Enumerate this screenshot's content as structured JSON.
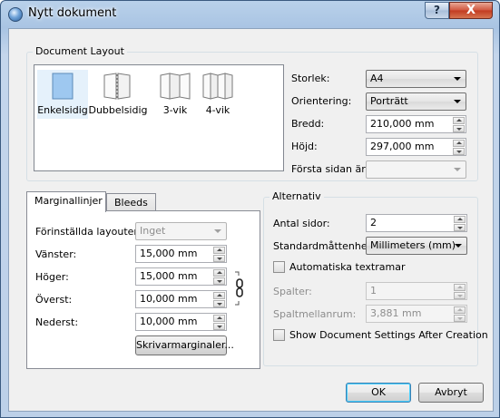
{
  "window": {
    "title": "Nytt dokument"
  },
  "titlebar_buttons": {
    "help": "?",
    "close": "X"
  },
  "document_layout": {
    "title": "Document Layout",
    "options": [
      {
        "label": "Enkelsidig",
        "selected": true
      },
      {
        "label": "Dubbelsidig",
        "selected": false
      },
      {
        "label": "3-vik",
        "selected": false
      },
      {
        "label": "4-vik",
        "selected": false
      }
    ],
    "size_label": "Storlek:",
    "size_value": "A4",
    "orientation_label": "Orientering:",
    "orientation_value": "Porträtt",
    "width_label": "Bredd:",
    "width_value": "210,000 mm",
    "height_label": "Höjd:",
    "height_value": "297,000 mm",
    "first_page_label": "Första sidan är:",
    "first_page_value": ""
  },
  "tabs": {
    "margins": "Marginallinjer",
    "bleeds": "Bleeds"
  },
  "margins": {
    "presets_label": "Förinställda layouter:",
    "presets_value": "Inget",
    "left_label": "Vänster:",
    "left_value": "15,000 mm",
    "right_label": "Höger:",
    "right_value": "15,000 mm",
    "top_label": "Överst:",
    "top_value": "10,000 mm",
    "bottom_label": "Nederst:",
    "bottom_value": "10,000 mm",
    "printer_margins_button": "Skrivarmarginaler..."
  },
  "alternativ": {
    "title": "Alternativ",
    "pages_label": "Antal sidor:",
    "pages_value": "2",
    "unit_label": "Standardmåttenhet:",
    "unit_value": "Millimeters (mm)",
    "auto_frames_label": "Automatiska textramar",
    "columns_label": "Spalter:",
    "columns_value": "1",
    "gap_label": "Spaltmellanrum:",
    "gap_value": "3,881 mm",
    "show_settings_label": "Show Document Settings After Creation"
  },
  "buttons": {
    "ok": "OK",
    "cancel": "Avbryt"
  }
}
